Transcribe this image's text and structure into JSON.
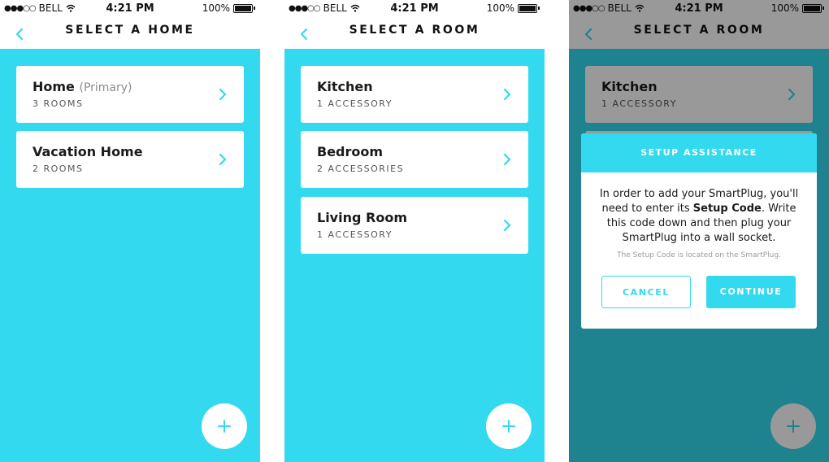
{
  "status": {
    "carrier": "BELL",
    "signal_dots": "●●●○○",
    "time": "4:21 PM",
    "battery": "100%"
  },
  "colors": {
    "accent": "#33d9ee",
    "card": "#ffffff",
    "text": "#1a1a1a",
    "overlay": "rgba(0,0,0,0.40)"
  },
  "icons": {
    "back": "chevron-left-icon",
    "row": "chevron-right-icon",
    "fab": "plus-icon",
    "wifi": "wifi-icon",
    "battery": "battery-icon"
  },
  "screens": [
    {
      "title": "SELECT A HOME",
      "items": [
        {
          "name": "Home",
          "sub": "(Primary)",
          "meta": "3 ROOMS"
        },
        {
          "name": "Vacation Home",
          "meta": "2 ROOMS"
        }
      ]
    },
    {
      "title": "SELECT A ROOM",
      "items": [
        {
          "name": "Kitchen",
          "meta": "1 ACCESSORY"
        },
        {
          "name": "Bedroom",
          "meta": "2 ACCESSORIES"
        },
        {
          "name": "Living Room",
          "meta": "1 ACCESSORY"
        }
      ]
    },
    {
      "title": "SELECT A ROOM",
      "items": [
        {
          "name": "Kitchen",
          "meta": "1 ACCESSORY"
        }
      ],
      "dialog": {
        "header": "SETUP ASSISTANCE",
        "body_pre": "In order to add your SmartPlug, you'll need to enter its ",
        "body_bold": "Setup Code",
        "body_post": ". Write this code down and then plug your SmartPlug into a wall socket.",
        "note": "The Setup Code is located on the SmartPlug.",
        "cancel_label": "CANCEL",
        "continue_label": "CONTINUE"
      }
    }
  ]
}
